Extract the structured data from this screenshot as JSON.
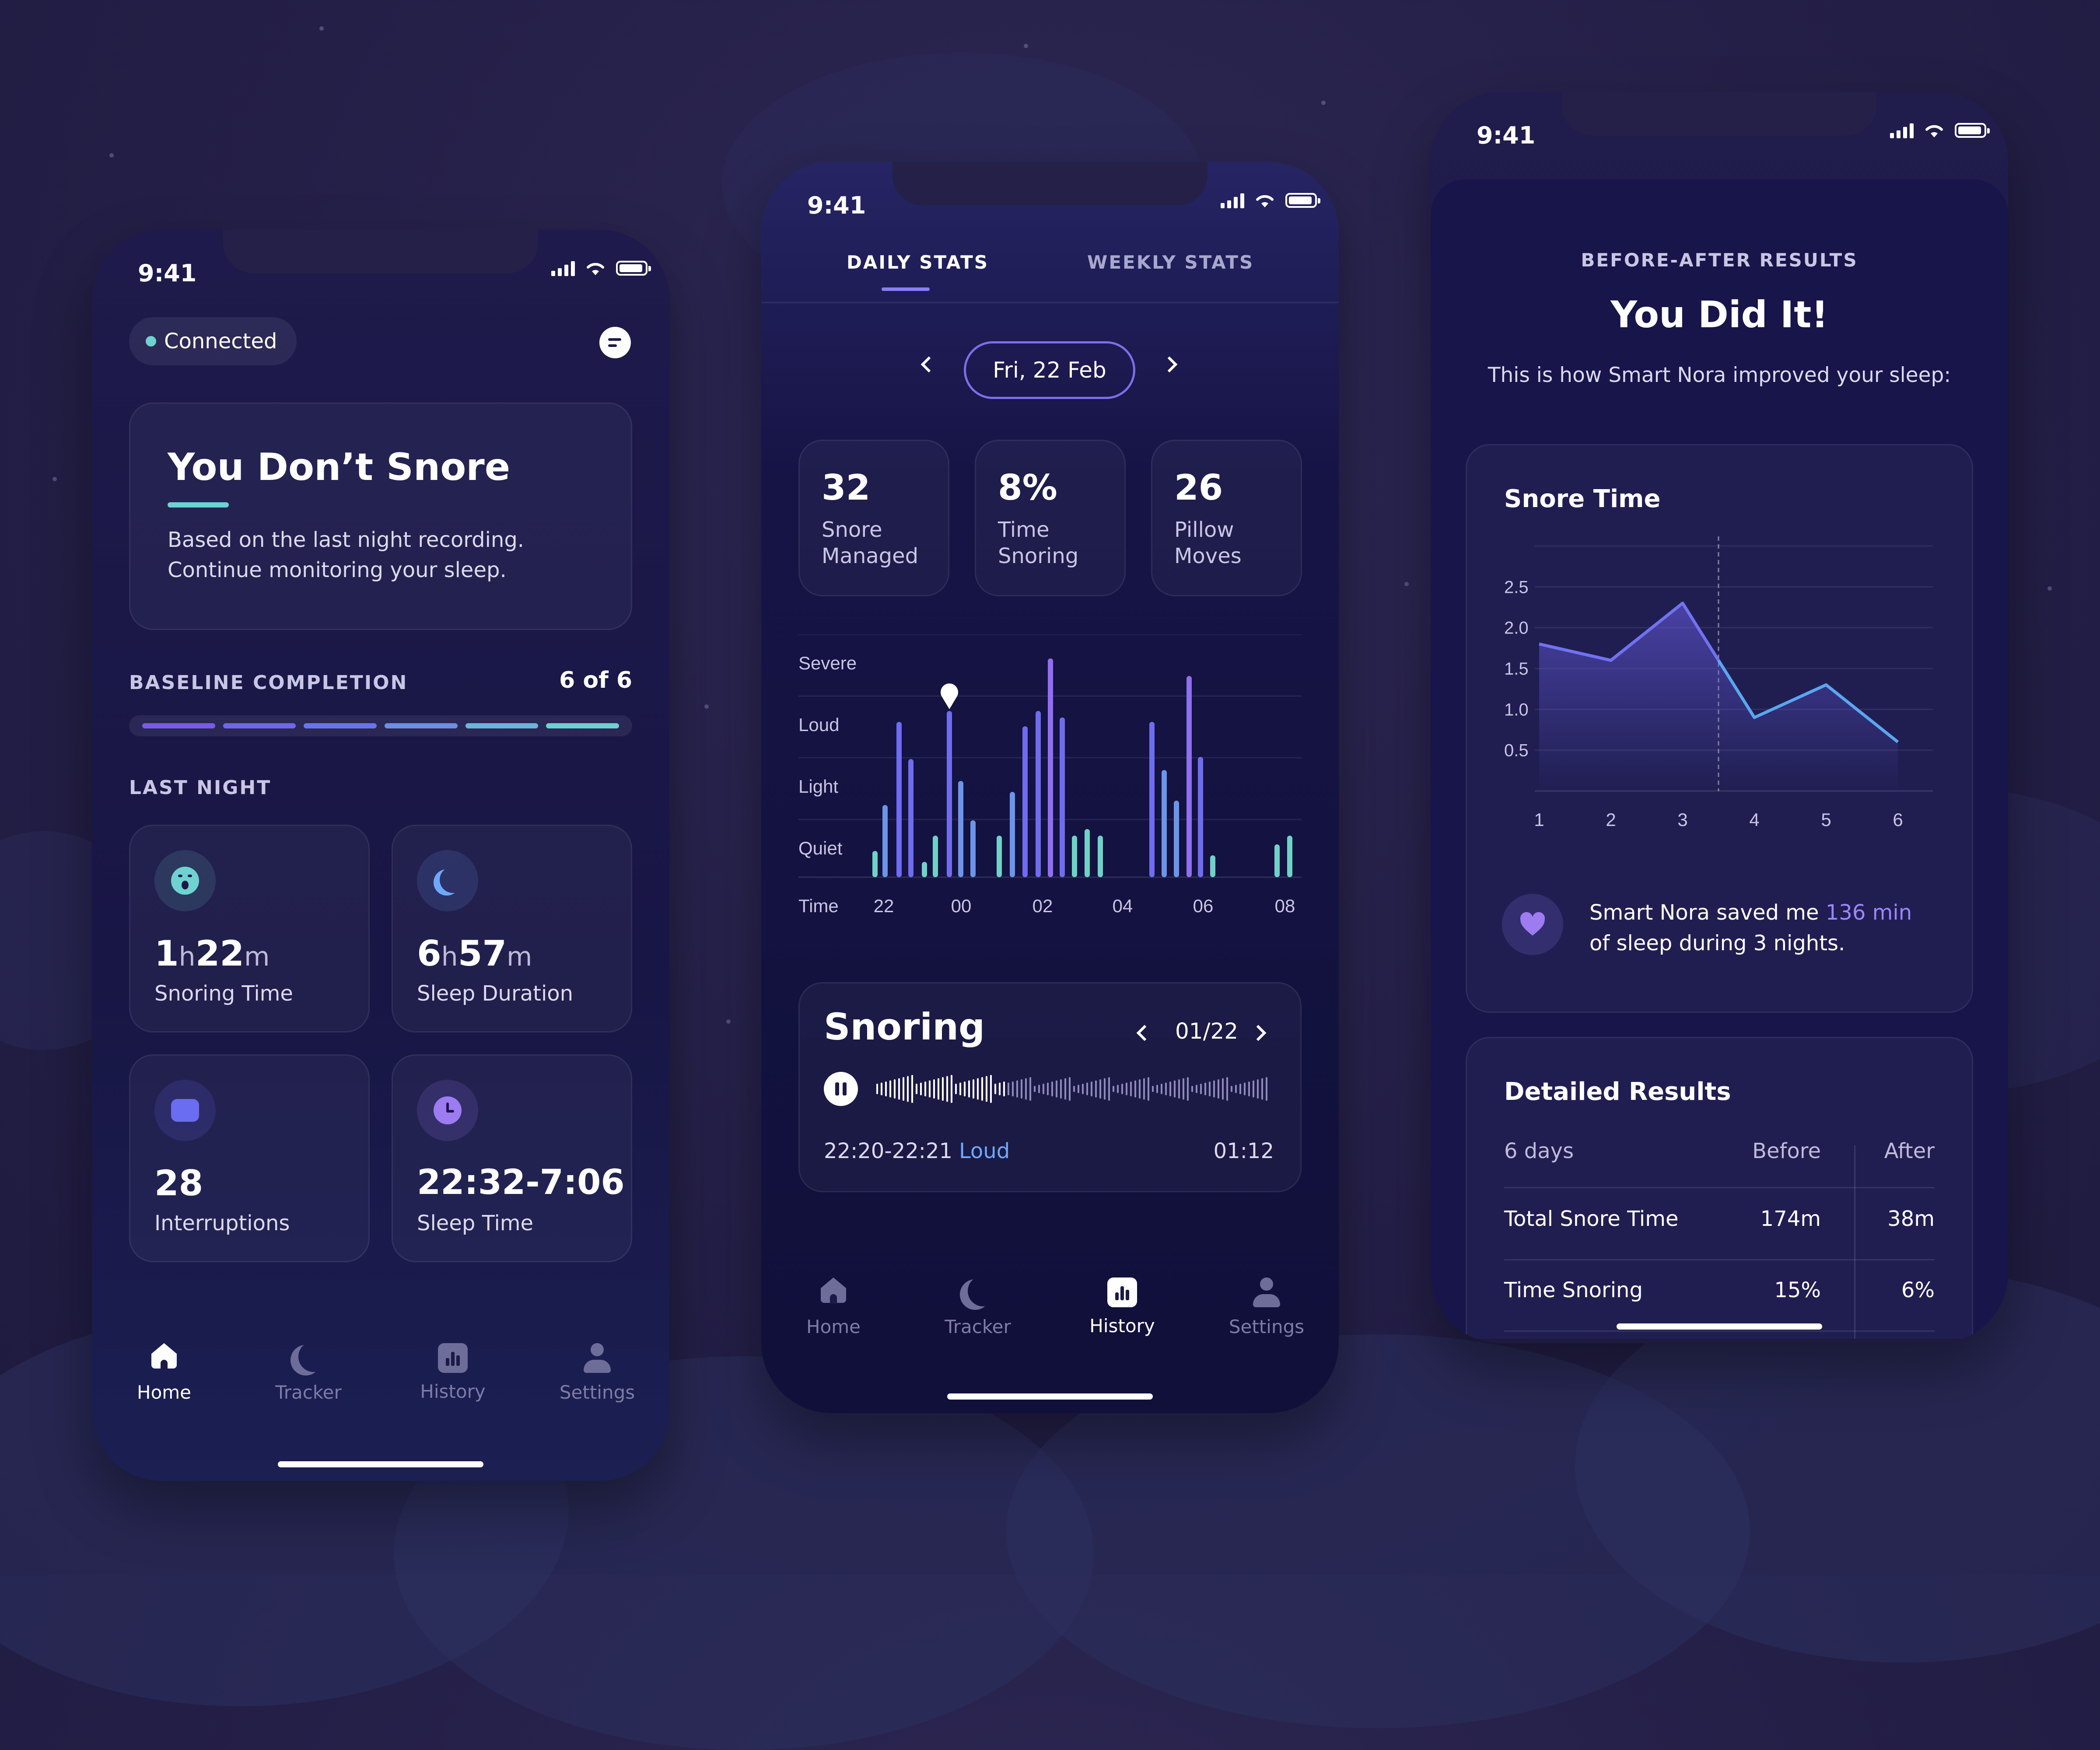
{
  "status_time": "9:41",
  "tabbar": {
    "home": "Home",
    "tracker": "Tracker",
    "history": "History",
    "settings": "Settings"
  },
  "home_screen": {
    "connection": "Connected",
    "message_icon": "chat-bubble-icon",
    "hero": {
      "title": "You Don’t Snore",
      "text1": "Based on the last night recording.",
      "text2": "Continue monitoring your sleep."
    },
    "baseline": {
      "label": "BASELINE COMPLETION",
      "value": "6 of 6",
      "segments_done": 6,
      "segments_total": 6
    },
    "last_night_label": "LAST NIGHT",
    "stats": [
      {
        "icon": "snoring-face-icon",
        "value_a": "1",
        "unit_a": "h",
        "value_b": "22",
        "unit_b": "m",
        "label": "Snoring Time",
        "color": "#6fd2d0"
      },
      {
        "icon": "moon-icon",
        "value_a": "6",
        "unit_a": "h",
        "value_b": "57",
        "unit_b": "m",
        "label": "Sleep Duration",
        "color": "#6fa8ff"
      },
      {
        "icon": "pillow-icon",
        "value": "28",
        "label": "Interruptions",
        "color": "#6a6cf2"
      },
      {
        "icon": "clock-icon",
        "value": "22:32-7:06",
        "label": "Sleep Time",
        "color": "#9c7cf0"
      }
    ]
  },
  "history_screen": {
    "tabs": {
      "daily": "DAILY STATS",
      "weekly": "WEEKLY STATS"
    },
    "date": "Fri, 22 Feb",
    "summary": [
      {
        "value": "32",
        "label1": "Snore",
        "label2": "Managed"
      },
      {
        "value": "8%",
        "label1": "Time",
        "label2": "Snoring"
      },
      {
        "value": "26",
        "label1": "Pillow",
        "label2": "Moves"
      }
    ],
    "chart_data": {
      "type": "bar",
      "y_levels": [
        "Severe",
        "Loud",
        "Light",
        "Quiet"
      ],
      "x_label": "Time",
      "x_ticks": [
        "22",
        "00",
        "02",
        "04",
        "06",
        "08"
      ],
      "bars": [
        0.12,
        0.33,
        0.71,
        0.54,
        0.07,
        0.19,
        0.76,
        0.44,
        0.26,
        0.19,
        0.39,
        0.69,
        0.76,
        1.0,
        0.73,
        0.19,
        0.22,
        0.19,
        0.71,
        0.49,
        0.35,
        0.92,
        0.55,
        0.1,
        0.15,
        0.19
      ],
      "marker_bar": 6
    },
    "snoring": {
      "title": "Snoring",
      "counter": "01/22",
      "time": "22:20-22:21",
      "level": "Loud",
      "duration": "01:12"
    }
  },
  "results_screen": {
    "eyebrow": "BEFORE-AFTER RESULTS",
    "title": "You Did It!",
    "subtitle": "This is how Smart Nora improved your sleep:",
    "chart_data": {
      "type": "area",
      "title": "Snore Time",
      "x": [
        1,
        2,
        3,
        4,
        5,
        6
      ],
      "values": [
        1.8,
        1.6,
        2.3,
        0.9,
        1.3,
        0.6
      ],
      "y_ticks": [
        "2.5",
        "2.0",
        "1.5",
        "1.0",
        "0.5"
      ],
      "ylim": [
        0,
        3
      ],
      "before_label": "Before",
      "after_label": "After",
      "divider_after_x": 3.5
    },
    "saved": {
      "pre": "Smart Nora saved me ",
      "highlight": "136 min",
      "post": "of sleep during 3 nights."
    },
    "detailed": {
      "title": "Detailed Results",
      "header": [
        "6 days",
        "Before",
        "After"
      ],
      "rows": [
        [
          "Total Snore Time",
          "174m",
          "38m"
        ],
        [
          "Time Snoring",
          "15%",
          "6%"
        ]
      ]
    }
  },
  "colors": {
    "accent": "#8a7cf5",
    "teal": "#6fd2d0",
    "blue": "#6fa8ff",
    "line": "#7072f0"
  }
}
